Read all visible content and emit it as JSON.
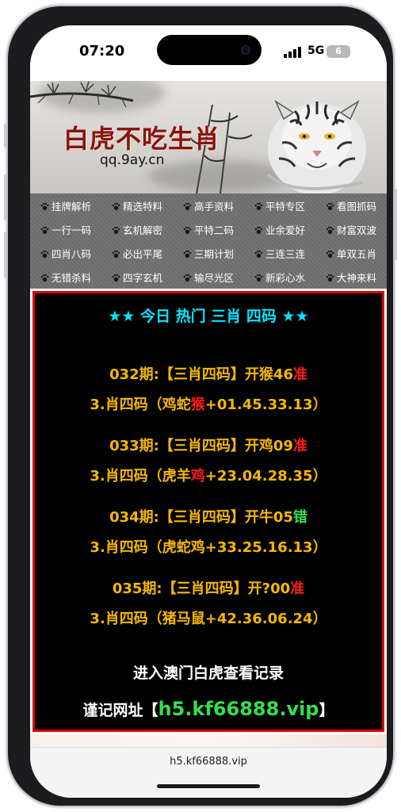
{
  "status_bar": {
    "time": "07:20",
    "network": "5G",
    "battery": "6"
  },
  "banner": {
    "title": "白虎不吃生肖",
    "subtitle": "qq.9ay.cn"
  },
  "nav": {
    "items": [
      "挂牌解析",
      "精选特料",
      "高手资料",
      "平特专区",
      "看图抓码",
      "一行一码",
      "玄机解密",
      "平特二码",
      "业余爱好",
      "财富双波",
      "四肖八码",
      "必出平尾",
      "三期计划",
      "三连三连",
      "单双五肖",
      "无错杀料",
      "四字玄机",
      "输尽光区",
      "新彩心水",
      "大神来料"
    ]
  },
  "content": {
    "headline": "★★ 今日 热门 三肖 四码 ★★",
    "records": [
      {
        "issue": "032期:【三肖四码】开猴46",
        "result": "准",
        "picks_prefix": "3.肖四码（鸡蛇",
        "picks_hit": "猴",
        "picks_suffix": "+01.45.33.13）"
      },
      {
        "issue": "033期:【三肖四码】开鸡09",
        "result": "准",
        "picks_prefix": "3.肖四码（虎羊",
        "picks_hit": "鸡",
        "picks_suffix": "+23.04.28.35）"
      },
      {
        "issue": "034期:【三肖四码】开牛05",
        "result": "错",
        "picks_prefix": "3.肖四码（虎蛇鸡+33.25.16.13）",
        "picks_hit": "",
        "picks_suffix": ""
      },
      {
        "issue": "035期:【三肖四码】开?00",
        "result": "准",
        "picks_prefix": "3.肖四码（猪马鼠+42.36.06.24）",
        "picks_hit": "",
        "picks_suffix": ""
      }
    ],
    "enter_text": "进入澳门白虎查看记录",
    "url_label": "谨记网址【",
    "url_value": "h5.kf66888.vip",
    "url_close": "】"
  },
  "browser": {
    "address": "h5.kf66888.vip"
  },
  "colors": {
    "headline": "#00e5ff",
    "text_gold": "#f5b800",
    "hit_red": "#ff1a1a",
    "miss_green": "#33e04d",
    "frame_red": "#e00000"
  }
}
